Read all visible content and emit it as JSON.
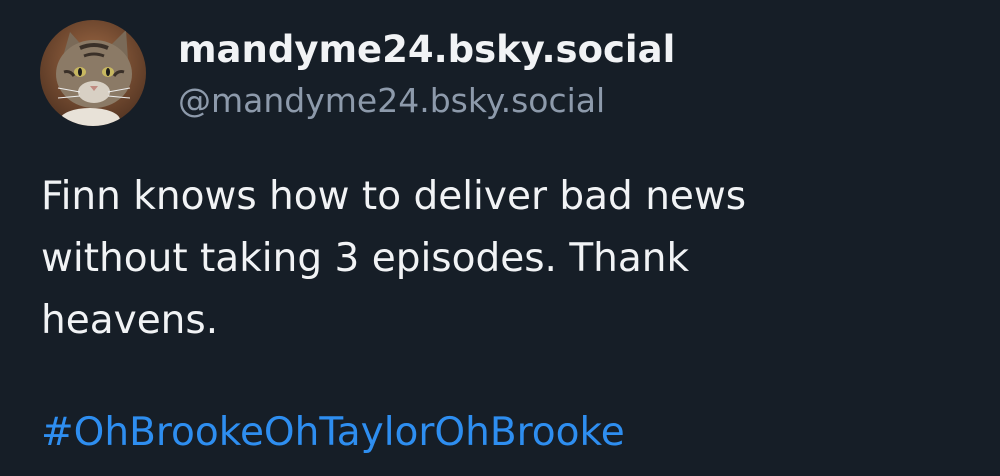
{
  "author": {
    "display_name": "mandyme24.bsky.social",
    "handle": "@mandyme24.bsky.social",
    "avatar_icon": "cat-avatar"
  },
  "post": {
    "lines": [
      "Finn knows how to deliver bad news",
      "without taking 3 episodes. Thank",
      "heavens."
    ],
    "hashtag": "#OhBrookeOhTaylorOhBrooke"
  },
  "colors": {
    "background": "#161e27",
    "text": "#f1f3f5",
    "muted": "#8d9aab",
    "link": "#2e8ef0"
  }
}
